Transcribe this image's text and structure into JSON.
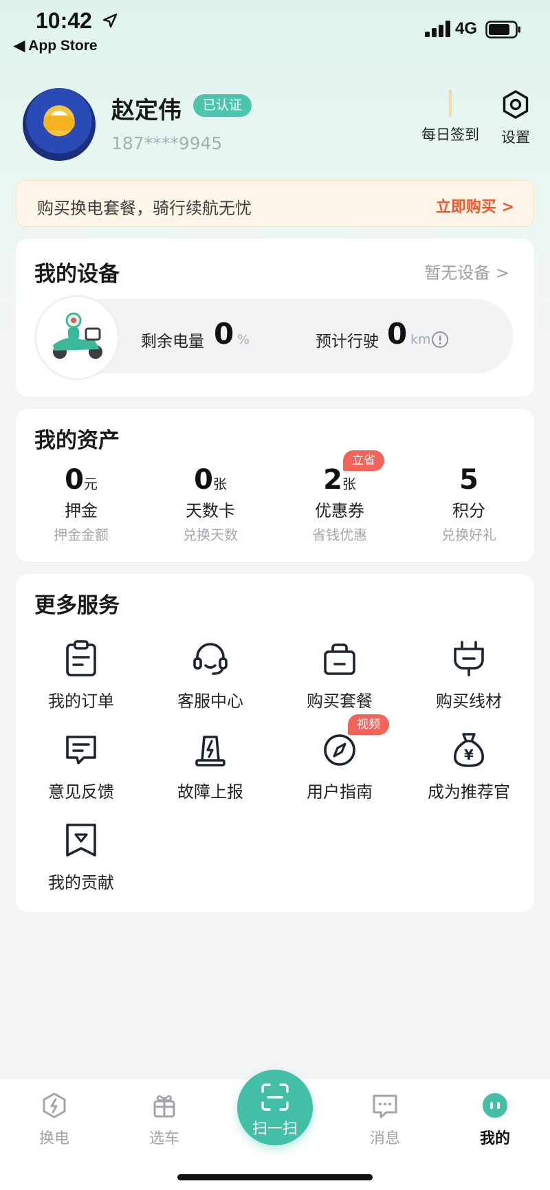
{
  "status_bar": {
    "time": "10:42",
    "back_label": "◀ App Store",
    "network": "4G"
  },
  "profile": {
    "name": "赵定伟",
    "verified_label": "已认证",
    "phone": "187****9945",
    "checkin_label": "每日签到",
    "settings_label": "设置"
  },
  "promo": {
    "text": "购买换电套餐，骑行续航无忧",
    "action": "立即购买 >"
  },
  "devices": {
    "title": "我的设备",
    "link": "暂无设备 >",
    "battery_label": "剩余电量",
    "battery_value": "0",
    "battery_unit": "%",
    "range_label": "预计行驶",
    "range_value": "0",
    "range_unit": "km"
  },
  "assets": {
    "title": "我的资产",
    "items": [
      {
        "value": "0",
        "unit": "元",
        "name": "押金",
        "sub": "押金金额"
      },
      {
        "value": "0",
        "unit": "张",
        "name": "天数卡",
        "sub": "兑换天数"
      },
      {
        "value": "2",
        "unit": "张",
        "name": "优惠券",
        "sub": "省钱优惠",
        "tag": "立省"
      },
      {
        "value": "5",
        "unit": "",
        "name": "积分",
        "sub": "兑换好礼"
      }
    ]
  },
  "services": {
    "title": "更多服务",
    "items": [
      {
        "label": "我的订单",
        "icon": "clipboard-icon"
      },
      {
        "label": "客服中心",
        "icon": "headset-icon"
      },
      {
        "label": "购买套餐",
        "icon": "bag-icon"
      },
      {
        "label": "购买线材",
        "icon": "plug-icon"
      },
      {
        "label": "意见反馈",
        "icon": "feedback-icon"
      },
      {
        "label": "故障上报",
        "icon": "alarm-icon"
      },
      {
        "label": "用户指南",
        "icon": "compass-icon",
        "tag": "视频"
      },
      {
        "label": "成为推荐官",
        "icon": "money-bag-icon"
      },
      {
        "label": "我的贡献",
        "icon": "diamond-badge-icon"
      }
    ]
  },
  "bottom_nav": {
    "items": [
      {
        "label": "换电",
        "icon": "battery-swap-icon"
      },
      {
        "label": "选车",
        "icon": "gift-car-icon"
      },
      {
        "label": "扫一扫",
        "icon": "scan-icon"
      },
      {
        "label": "消息",
        "icon": "message-icon"
      },
      {
        "label": "我的",
        "icon": "profile-icon",
        "active": true
      }
    ]
  },
  "colors": {
    "accent": "#43bfa8",
    "promo_action": "#f0572e",
    "tag": "#f2645a"
  }
}
